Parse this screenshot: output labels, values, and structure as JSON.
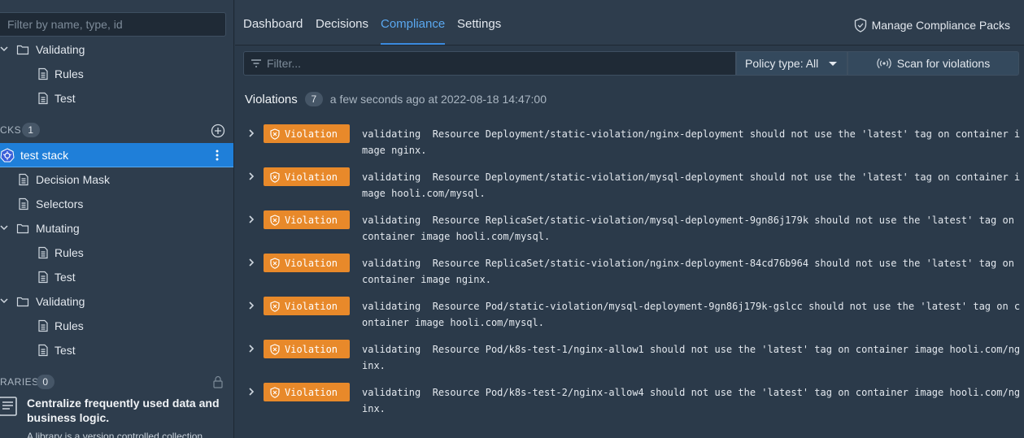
{
  "sidebar": {
    "filter_placeholder": "Filter by name, type, id",
    "tree_top": [
      {
        "label": "Validating",
        "type": "folder"
      },
      {
        "label": "Rules",
        "type": "file"
      },
      {
        "label": "Test",
        "type": "file"
      }
    ],
    "stacks_header": "CKS",
    "stacks_count": "1",
    "stack_name": "test stack",
    "stack_children": [
      {
        "label": "Decision Mask"
      },
      {
        "label": "Selectors"
      },
      {
        "label": "Mutating"
      },
      {
        "label": "Rules"
      },
      {
        "label": "Test"
      },
      {
        "label": "Validating"
      },
      {
        "label": "Rules"
      },
      {
        "label": "Test"
      }
    ],
    "libraries_header": "RARIES",
    "libraries_count": "0",
    "promo_title": "Centralize frequently used data and business logic.",
    "promo_body": "A library is a version controlled collection"
  },
  "tabs": [
    {
      "label": "Dashboard"
    },
    {
      "label": "Decisions"
    },
    {
      "label": "Compliance"
    },
    {
      "label": "Settings"
    }
  ],
  "manage_packs_label": "Manage Compliance Packs",
  "filter": {
    "placeholder": "Filter...",
    "policy_type": "Policy type: All",
    "scan_label": "Scan for violations"
  },
  "violations": {
    "title": "Violations",
    "count": "7",
    "timestamp": "a few seconds ago at 2022-08-18 14:47:00",
    "badge_label": "Violation",
    "items": [
      {
        "text": "validating  Resource Deployment/static-violation/nginx-deployment should not use the 'latest' tag on container image nginx."
      },
      {
        "text": "validating  Resource Deployment/static-violation/mysql-deployment should not use the 'latest' tag on container image hooli.com/mysql."
      },
      {
        "text": "validating  Resource ReplicaSet/static-violation/mysql-deployment-9gn86j179k should not use the 'latest' tag on container image hooli.com/mysql."
      },
      {
        "text": "validating  Resource ReplicaSet/static-violation/nginx-deployment-84cd76b964 should not use the 'latest' tag on container image nginx."
      },
      {
        "text": "validating  Resource Pod/static-violation/mysql-deployment-9gn86j179k-gslcc should not use the 'latest' tag on container image hooli.com/mysql."
      },
      {
        "text": "validating  Resource Pod/k8s-test-1/nginx-allow1 should not use the 'latest' tag on container image hooli.com/nginx."
      },
      {
        "text": "validating  Resource Pod/k8s-test-2/nginx-allow4 should not use the 'latest' tag on container image hooli.com/nginx."
      }
    ]
  }
}
